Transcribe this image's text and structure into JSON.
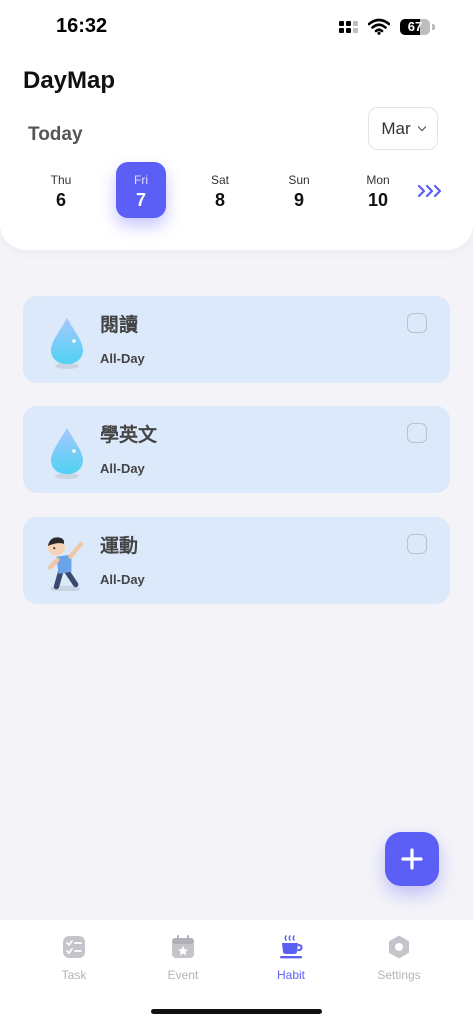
{
  "status_bar": {
    "time": "16:32",
    "battery": "67",
    "battery_level": 0.67,
    "icons": [
      "cellular-signal-icon",
      "wifi-icon",
      "battery-icon"
    ]
  },
  "header": {
    "app_title": "DayMap",
    "today_label": "Today",
    "month": "Mar"
  },
  "days": [
    {
      "dow": "Thu",
      "num": "6",
      "selected": false
    },
    {
      "dow": "Fri",
      "num": "7",
      "selected": true
    },
    {
      "dow": "Sat",
      "num": "8",
      "selected": false
    },
    {
      "dow": "Sun",
      "num": "9",
      "selected": false
    },
    {
      "dow": "Mon",
      "num": "10",
      "selected": false
    }
  ],
  "more_days_icon": "triple-chevron-right-icon",
  "habits": [
    {
      "name": "閱讀",
      "time": "All-Day",
      "icon": "water-drop-icon",
      "checked": false
    },
    {
      "name": "學英文",
      "time": "All-Day",
      "icon": "water-drop-icon",
      "checked": false
    },
    {
      "name": "運動",
      "time": "All-Day",
      "icon": "exercise-person-icon",
      "checked": false
    }
  ],
  "fab": {
    "icon": "plus-icon"
  },
  "tabs": [
    {
      "label": "Task",
      "icon": "task-icon",
      "active": false
    },
    {
      "label": "Event",
      "icon": "event-calendar-icon",
      "active": false
    },
    {
      "label": "Habit",
      "icon": "coffee-cup-icon",
      "active": true
    },
    {
      "label": "Settings",
      "icon": "settings-hexagon-icon",
      "active": false
    }
  ],
  "colors": {
    "accent": "#5b5ff6",
    "card_bg": "#dce9fb",
    "page_bg": "#f4f4f8",
    "inactive_tab": "#b4b4bc"
  }
}
